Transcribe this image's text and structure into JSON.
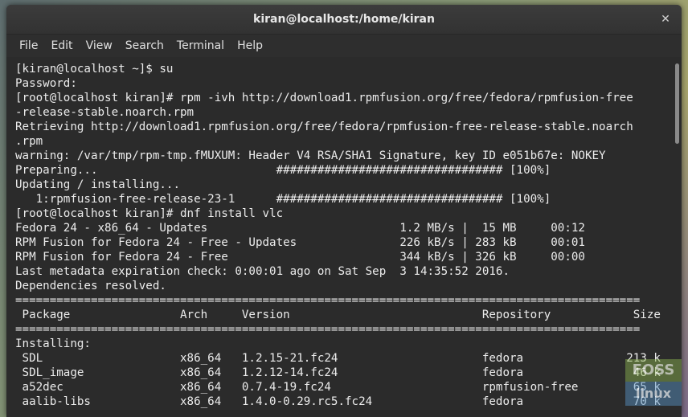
{
  "window": {
    "title": "kiran@localhost:/home/kiran",
    "close_glyph": "✕"
  },
  "menu": {
    "items": [
      "File",
      "Edit",
      "View",
      "Search",
      "Terminal",
      "Help"
    ]
  },
  "terminal": {
    "lines": [
      "[kiran@localhost ~]$ su",
      "Password:",
      "[root@localhost kiran]# rpm -ivh http://download1.rpmfusion.org/free/fedora/rpmfusion-free",
      "-release-stable.noarch.rpm",
      "Retrieving http://download1.rpmfusion.org/free/fedora/rpmfusion-free-release-stable.noarch",
      ".rpm",
      "warning: /var/tmp/rpm-tmp.fMUXUM: Header V4 RSA/SHA1 Signature, key ID e051b67e: NOKEY",
      "Preparing...                          ################################# [100%]",
      "Updating / installing...",
      "   1:rpmfusion-free-release-23-1      ################################# [100%]",
      "[root@localhost kiran]# dnf install vlc",
      "Fedora 24 - x86_64 - Updates                            1.2 MB/s |  15 MB     00:12",
      "RPM Fusion for Fedora 24 - Free - Updates               226 kB/s | 283 kB     00:01",
      "RPM Fusion for Fedora 24 - Free                         344 kB/s | 326 kB     00:00",
      "Last metadata expiration check: 0:00:01 ago on Sat Sep  3 14:35:52 2016.",
      "Dependencies resolved.",
      "===========================================================================================",
      " Package                Arch     Version                            Repository            Size",
      "===========================================================================================",
      "Installing:",
      " SDL                    x86_64   1.2.15-21.fc24                     fedora               213 k",
      " SDL_image              x86_64   1.2.12-14.fc24                     fedora                46 k",
      " a52dec                 x86_64   0.7.4-19.fc24                      rpmfusion-free        65 k",
      " aalib-libs             x86_64   1.4.0-0.29.rc5.fc24                fedora                70 k"
    ]
  },
  "watermark": {
    "top": "FOSS",
    "bottom": "linux"
  }
}
